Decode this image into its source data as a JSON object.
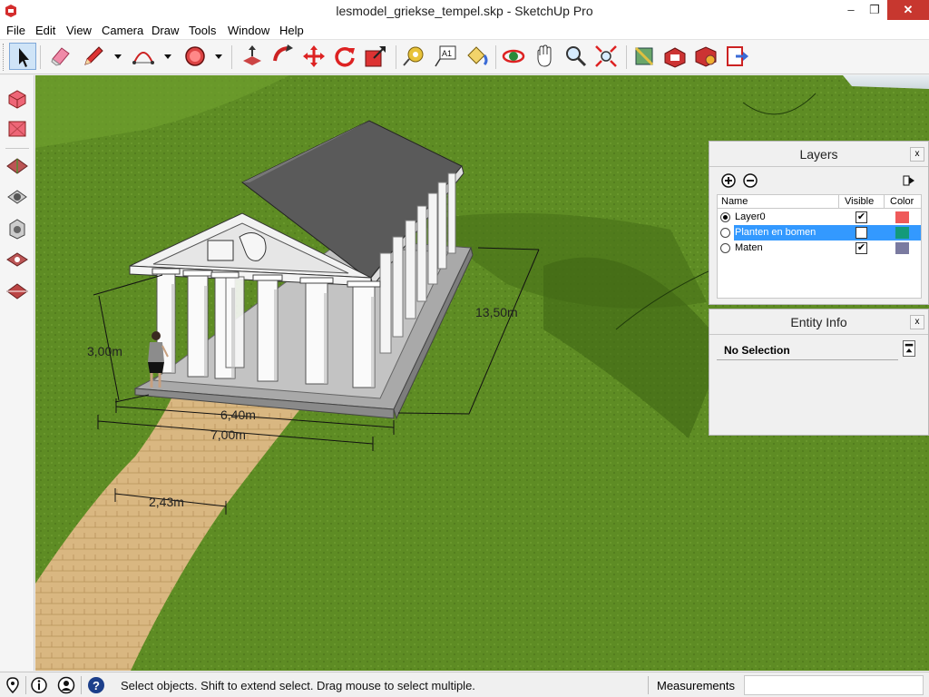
{
  "window": {
    "title": "lesmodel_griekse_tempel.skp - SketchUp Pro",
    "minimize": "–",
    "maximize": "❐",
    "close": "✕"
  },
  "menu": [
    "File",
    "Edit",
    "View",
    "Camera",
    "Draw",
    "Tools",
    "Window",
    "Help"
  ],
  "toolbar": {
    "tools": [
      "select-icon",
      "eraser-icon",
      "pencil-icon",
      "arc-icon",
      "shape-icon",
      "push-pull-icon",
      "follow-me-icon",
      "move-icon",
      "rotate-icon",
      "scale-icon",
      "tape-measure-icon",
      "text-icon",
      "paint-bucket-icon",
      "orbit-icon",
      "pan-icon",
      "zoom-icon",
      "zoom-extents-icon",
      "3d-warehouse-icon",
      "extension-warehouse-icon",
      "layout-icon",
      "send-to-layout-icon"
    ]
  },
  "scene": {
    "dimensions": {
      "height": "3,00m",
      "depth": "13,50m",
      "inner_width": "6,40m",
      "outer_width": "7,00m",
      "path_width": "2,43m"
    }
  },
  "layers_panel": {
    "title": "Layers",
    "close": "x",
    "columns": {
      "name": "Name",
      "visible": "Visible",
      "color": "Color"
    },
    "rows": [
      {
        "name": "Layer0",
        "active": true,
        "visible": true,
        "color": "#ef5a5a",
        "selected": false
      },
      {
        "name": "Planten en bomen",
        "active": false,
        "visible": false,
        "color": "#139a7a",
        "selected": true
      },
      {
        "name": "Maten",
        "active": false,
        "visible": true,
        "color": "#7a7aa0",
        "selected": false
      }
    ]
  },
  "entity_panel": {
    "title": "Entity Info",
    "close": "x",
    "selection": "No Selection"
  },
  "status": {
    "message": "Select objects. Shift to extend select. Drag mouse to select multiple.",
    "measurements_label": "Measurements",
    "measurements_value": ""
  }
}
